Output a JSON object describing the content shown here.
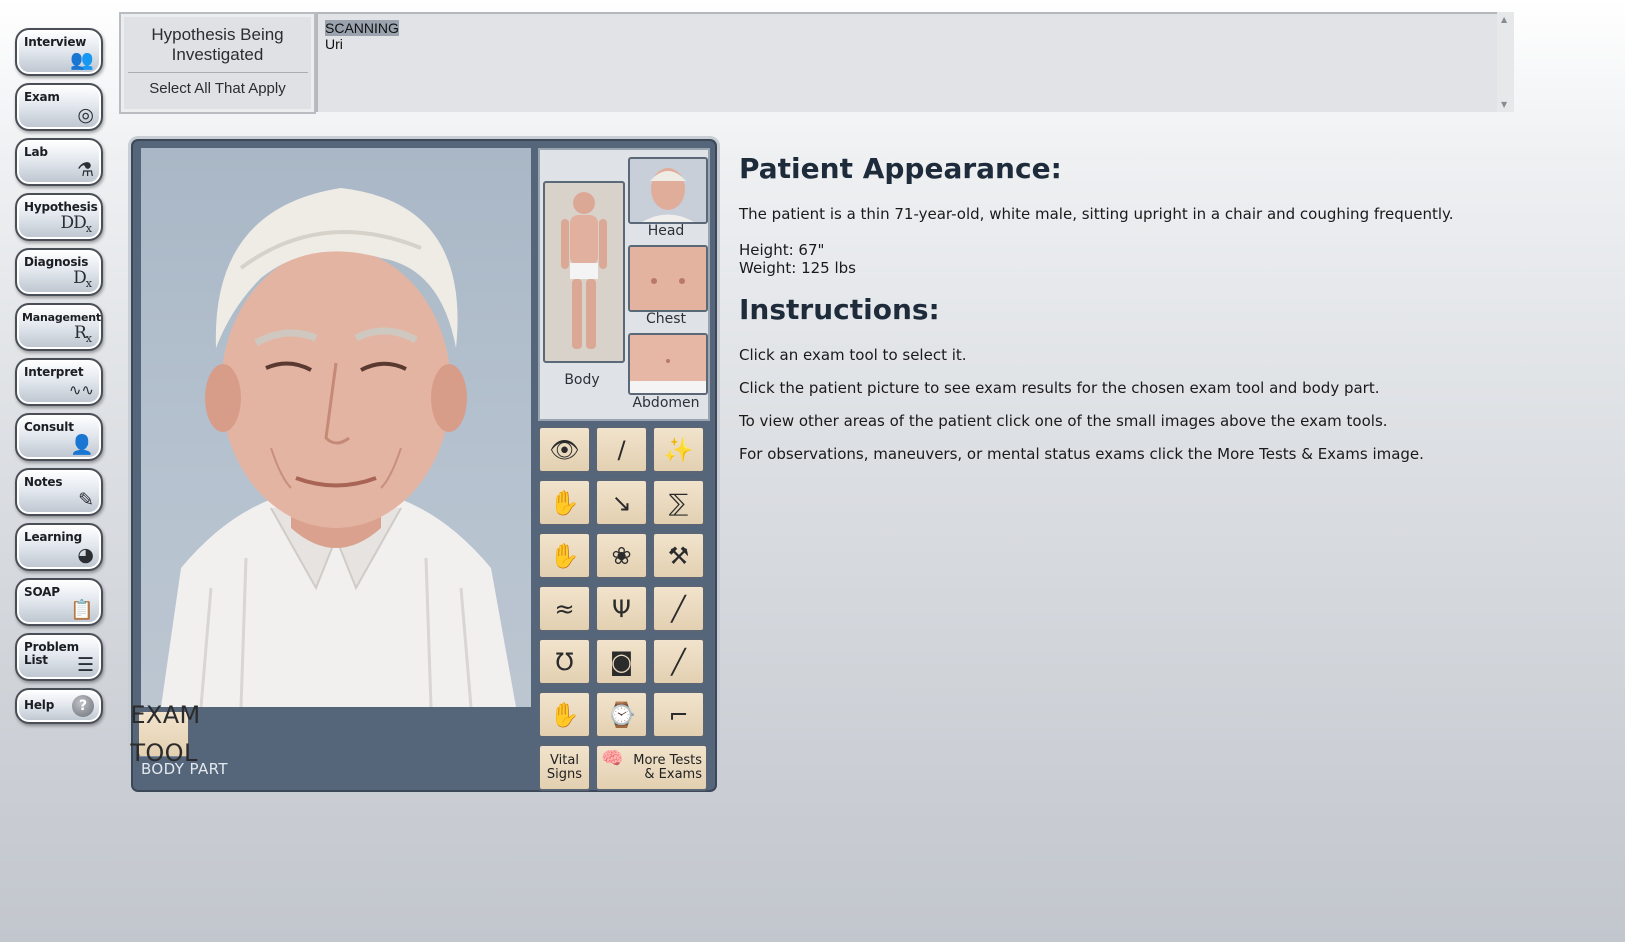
{
  "nav": {
    "interview": "Interview",
    "exam": "Exam",
    "lab": "Lab",
    "hypothesis": "Hypothesis",
    "hypothesis_sub": "DD",
    "hypothesis_sub_x": "x",
    "diagnosis": "Diagnosis",
    "diagnosis_sub": "D",
    "diagnosis_sub_x": "x",
    "management": "Management",
    "management_sub": "R",
    "management_sub_x": "x",
    "interpret": "Interpret",
    "consult": "Consult",
    "notes": "Notes",
    "learning": "Learning",
    "soap": "SOAP",
    "problem_list": "Problem\nList",
    "help": "Help"
  },
  "hypothesis": {
    "title": "Hypothesis Being Investigated",
    "select_hint": "Select All That Apply",
    "items": [
      "SCANNING",
      "Uri"
    ]
  },
  "exam": {
    "body_labels": {
      "body": "Body",
      "head": "Head",
      "chest": "Chest",
      "abdomen": "Abdomen"
    },
    "footer": {
      "exam_tool": "EXAM TOOL",
      "body_part": "BODY PART"
    },
    "vital_signs": "Vital Signs",
    "more_tests": "More Tests & Exams"
  },
  "info": {
    "appearance_heading": "Patient Appearance:",
    "appearance_text": "The patient is a thin 71-year-old, white male, sitting upright in a chair and coughing frequently.",
    "height": "Height: 67\"",
    "weight": "Weight: 125 lbs",
    "instructions_heading": "Instructions:",
    "instructions": [
      "Click an exam tool to select it.",
      "Click the patient picture to see exam results for the chosen exam tool and body part.",
      "To view other areas of the patient click one of the small images above the exam tools.",
      "For observations, maneuvers, or mental status exams click the More Tests & Exams image."
    ]
  },
  "colors": {
    "panel": "#55657a",
    "tool_tile": "#e8d7ba",
    "heading": "#1d2b3a"
  }
}
